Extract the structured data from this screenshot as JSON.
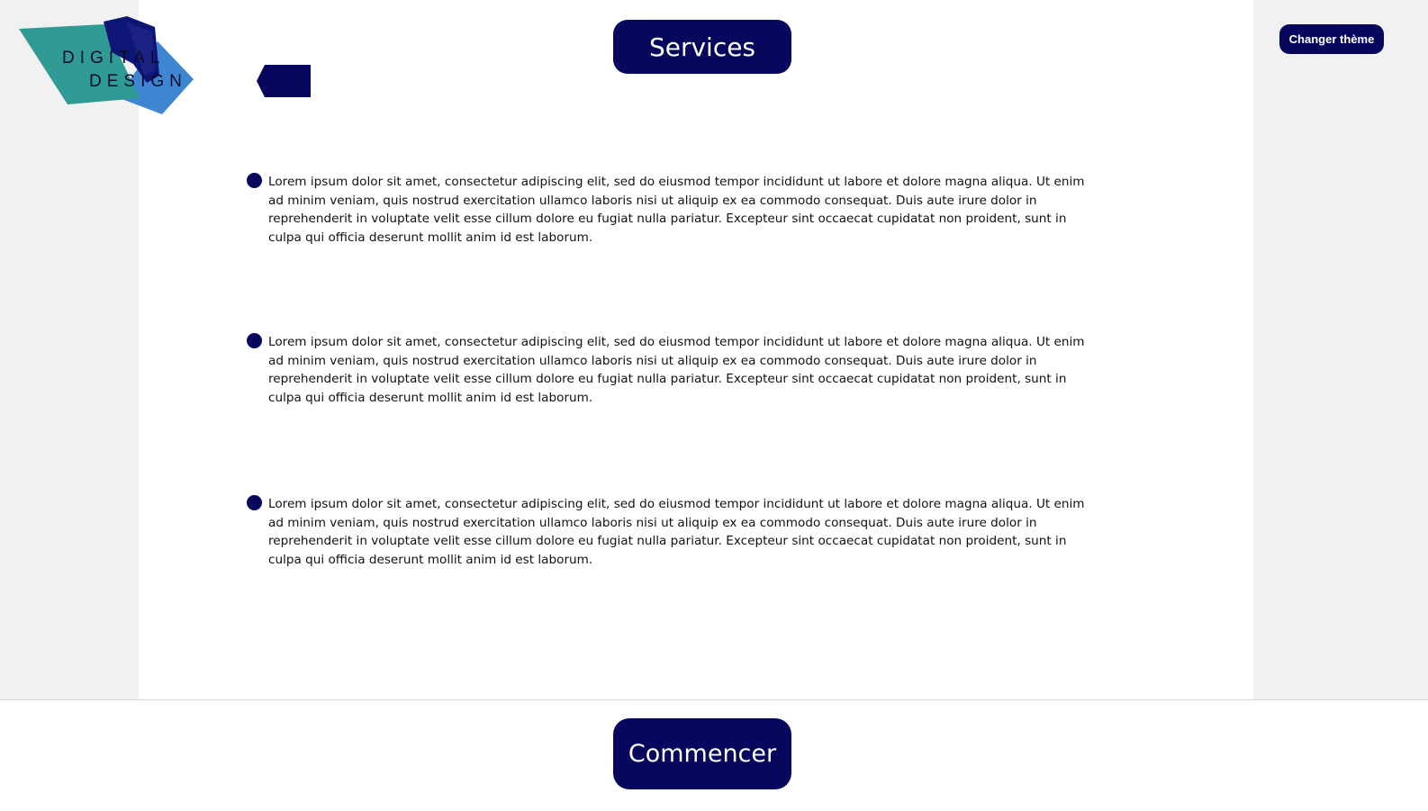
{
  "logo": {
    "line1": "DIGITAL",
    "line2": "DESIGN",
    "colors": {
      "teal": "#2f9b94",
      "navy": "#0d1675",
      "blue": "#3f86d2"
    }
  },
  "header": {
    "title": "Services",
    "back_icon": "back-arrow-icon",
    "theme_button_label": "Changer thème"
  },
  "services": [
    {
      "icon": "bullet-dot-icon",
      "text": "Lorem ipsum dolor sit amet, consectetur adipiscing elit, sed do eiusmod tempor incididunt ut labore et dolore magna aliqua. Ut enim ad minim veniam, quis nostrud exercitation ullamco laboris nisi ut aliquip ex ea commodo consequat. Duis aute irure dolor in reprehenderit in voluptate velit esse cillum dolore eu fugiat nulla pariatur. Excepteur sint occaecat cupidatat non proident, sunt in culpa qui officia deserunt mollit anim id est laborum."
    },
    {
      "icon": "bullet-dot-icon",
      "text": "Lorem ipsum dolor sit amet, consectetur adipiscing elit, sed do eiusmod tempor incididunt ut labore et dolore magna aliqua. Ut enim ad minim veniam, quis nostrud exercitation ullamco laboris nisi ut aliquip ex ea commodo consequat. Duis aute irure dolor in reprehenderit in voluptate velit esse cillum dolore eu fugiat nulla pariatur. Excepteur sint occaecat cupidatat non proident, sunt in culpa qui officia deserunt mollit anim id est laborum."
    },
    {
      "icon": "bullet-dot-icon",
      "text": "Lorem ipsum dolor sit amet, consectetur adipiscing elit, sed do eiusmod tempor incididunt ut labore et dolore magna aliqua. Ut enim ad minim veniam, quis nostrud exercitation ullamco laboris nisi ut aliquip ex ea commodo consequat. Duis aute irure dolor in reprehenderit in voluptate velit esse cillum dolore eu fugiat nulla pariatur. Excepteur sint occaecat cupidatat non proident, sunt in culpa qui officia deserunt mollit anim id est laborum."
    }
  ],
  "footer": {
    "start_button_label": "Commencer"
  },
  "colors": {
    "accent": "#07075e",
    "background": "#f1f1f1",
    "panel": "#ffffff"
  }
}
